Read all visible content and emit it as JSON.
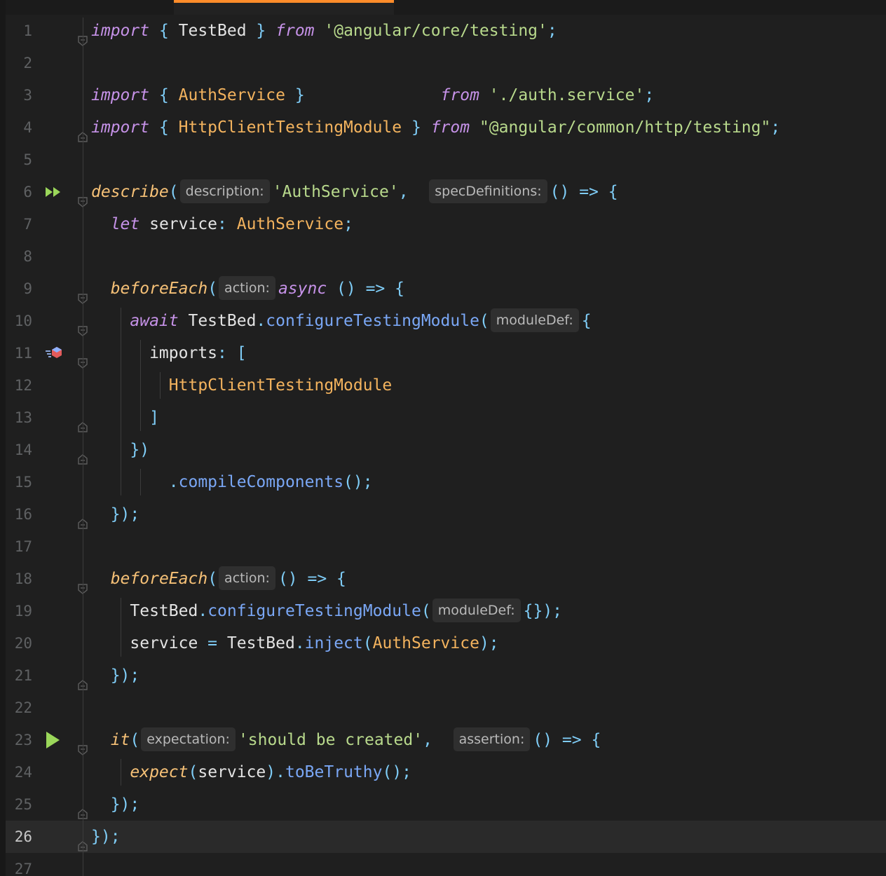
{
  "editor": {
    "current_line": 26,
    "lines": [
      {
        "n": "1",
        "tokens": [
          {
            "t": "import",
            "c": "kw"
          },
          {
            "t": " { ",
            "c": "pun"
          },
          {
            "t": "TestBed",
            "c": "plain"
          },
          {
            "t": " } ",
            "c": "pun"
          },
          {
            "t": "from",
            "c": "kw"
          },
          {
            "t": " ",
            "c": "plain"
          },
          {
            "t": "'@angular/core/testing'",
            "c": "str"
          },
          {
            "t": ";",
            "c": "pun"
          }
        ]
      },
      {
        "n": "2",
        "tokens": []
      },
      {
        "n": "3",
        "tokens": [
          {
            "t": "import",
            "c": "kw"
          },
          {
            "t": " { ",
            "c": "pun"
          },
          {
            "t": "AuthService",
            "c": "cls"
          },
          {
            "t": " }              ",
            "c": "pun"
          },
          {
            "t": "from",
            "c": "kw"
          },
          {
            "t": " ",
            "c": "plain"
          },
          {
            "t": "'./auth.service'",
            "c": "str"
          },
          {
            "t": ";",
            "c": "pun"
          }
        ]
      },
      {
        "n": "4",
        "tokens": [
          {
            "t": "import",
            "c": "kw"
          },
          {
            "t": " { ",
            "c": "pun"
          },
          {
            "t": "HttpClientTestingModule",
            "c": "cls"
          },
          {
            "t": " } ",
            "c": "pun"
          },
          {
            "t": "from",
            "c": "kw"
          },
          {
            "t": " ",
            "c": "plain"
          },
          {
            "t": "\"@angular/common/http/testing\"",
            "c": "str"
          },
          {
            "t": ";",
            "c": "pun"
          }
        ]
      },
      {
        "n": "5",
        "tokens": []
      },
      {
        "n": "6",
        "tokens": [
          {
            "t": "describe",
            "c": "fn"
          },
          {
            "t": "(",
            "c": "pun"
          },
          {
            "t": "description:",
            "c": "hint"
          },
          {
            "t": "'AuthService'",
            "c": "str"
          },
          {
            "t": ",  ",
            "c": "pun"
          },
          {
            "t": "specDefinitions:",
            "c": "hint"
          },
          {
            "t": "() => {",
            "c": "pun"
          }
        ]
      },
      {
        "n": "7",
        "tokens": [
          {
            "t": "  ",
            "c": "plain"
          },
          {
            "t": "let",
            "c": "kw"
          },
          {
            "t": " service",
            "c": "plain"
          },
          {
            "t": ": ",
            "c": "pun"
          },
          {
            "t": "AuthService",
            "c": "cls"
          },
          {
            "t": ";",
            "c": "pun"
          }
        ]
      },
      {
        "n": "8",
        "tokens": []
      },
      {
        "n": "9",
        "tokens": [
          {
            "t": "  ",
            "c": "plain"
          },
          {
            "t": "beforeEach",
            "c": "fn"
          },
          {
            "t": "(",
            "c": "pun"
          },
          {
            "t": "action:",
            "c": "hint"
          },
          {
            "t": "async",
            "c": "kw"
          },
          {
            "t": " () => {",
            "c": "pun"
          }
        ]
      },
      {
        "n": "10",
        "tokens": [
          {
            "t": "    ",
            "c": "plain"
          },
          {
            "t": "await",
            "c": "kw"
          },
          {
            "t": " TestBed",
            "c": "plain"
          },
          {
            "t": ".",
            "c": "pun"
          },
          {
            "t": "configureTestingModule",
            "c": "meth"
          },
          {
            "t": "(",
            "c": "pun"
          },
          {
            "t": "moduleDef:",
            "c": "hint"
          },
          {
            "t": "{",
            "c": "pun"
          }
        ]
      },
      {
        "n": "11",
        "tokens": [
          {
            "t": "      imports",
            "c": "plain"
          },
          {
            "t": ": [",
            "c": "pun"
          }
        ]
      },
      {
        "n": "12",
        "tokens": [
          {
            "t": "        ",
            "c": "plain"
          },
          {
            "t": "HttpClientTestingModule",
            "c": "cls"
          }
        ]
      },
      {
        "n": "13",
        "tokens": [
          {
            "t": "      ",
            "c": "plain"
          },
          {
            "t": "]",
            "c": "pun"
          }
        ]
      },
      {
        "n": "14",
        "tokens": [
          {
            "t": "    ",
            "c": "plain"
          },
          {
            "t": "})",
            "c": "pun"
          }
        ]
      },
      {
        "n": "15",
        "tokens": [
          {
            "t": "        ",
            "c": "plain"
          },
          {
            "t": ".",
            "c": "pun"
          },
          {
            "t": "compileComponents",
            "c": "meth"
          },
          {
            "t": "();",
            "c": "pun"
          }
        ]
      },
      {
        "n": "16",
        "tokens": [
          {
            "t": "  ",
            "c": "plain"
          },
          {
            "t": "});",
            "c": "pun"
          }
        ]
      },
      {
        "n": "17",
        "tokens": []
      },
      {
        "n": "18",
        "tokens": [
          {
            "t": "  ",
            "c": "plain"
          },
          {
            "t": "beforeEach",
            "c": "fn"
          },
          {
            "t": "(",
            "c": "pun"
          },
          {
            "t": "action:",
            "c": "hint"
          },
          {
            "t": "() => {",
            "c": "pun"
          }
        ]
      },
      {
        "n": "19",
        "tokens": [
          {
            "t": "    TestBed",
            "c": "plain"
          },
          {
            "t": ".",
            "c": "pun"
          },
          {
            "t": "configureTestingModule",
            "c": "meth"
          },
          {
            "t": "(",
            "c": "pun"
          },
          {
            "t": "moduleDef:",
            "c": "hint"
          },
          {
            "t": "{});",
            "c": "pun"
          }
        ]
      },
      {
        "n": "20",
        "tokens": [
          {
            "t": "    service ",
            "c": "plain"
          },
          {
            "t": "=",
            "c": "pun"
          },
          {
            "t": " TestBed",
            "c": "plain"
          },
          {
            "t": ".",
            "c": "pun"
          },
          {
            "t": "inject",
            "c": "meth"
          },
          {
            "t": "(",
            "c": "pun"
          },
          {
            "t": "AuthService",
            "c": "cls"
          },
          {
            "t": ");",
            "c": "pun"
          }
        ]
      },
      {
        "n": "21",
        "tokens": [
          {
            "t": "  ",
            "c": "plain"
          },
          {
            "t": "});",
            "c": "pun"
          }
        ]
      },
      {
        "n": "22",
        "tokens": []
      },
      {
        "n": "23",
        "tokens": [
          {
            "t": "  ",
            "c": "plain"
          },
          {
            "t": "it",
            "c": "fn"
          },
          {
            "t": "(",
            "c": "pun"
          },
          {
            "t": "expectation:",
            "c": "hint"
          },
          {
            "t": "'should be created'",
            "c": "str"
          },
          {
            "t": ",  ",
            "c": "pun"
          },
          {
            "t": "assertion:",
            "c": "hint"
          },
          {
            "t": "() => {",
            "c": "pun"
          }
        ]
      },
      {
        "n": "24",
        "tokens": [
          {
            "t": "    ",
            "c": "plain"
          },
          {
            "t": "expect",
            "c": "fn"
          },
          {
            "t": "(",
            "c": "pun"
          },
          {
            "t": "service",
            "c": "plain"
          },
          {
            "t": ").",
            "c": "pun"
          },
          {
            "t": "toBeTruthy",
            "c": "meth"
          },
          {
            "t": "();",
            "c": "pun"
          }
        ]
      },
      {
        "n": "25",
        "tokens": [
          {
            "t": "  ",
            "c": "plain"
          },
          {
            "t": "});",
            "c": "pun"
          }
        ]
      },
      {
        "n": "26",
        "tokens": [
          {
            "t": "});",
            "c": "pun"
          }
        ]
      },
      {
        "n": "27",
        "tokens": []
      }
    ],
    "gutter_icons": {
      "6": "run-all-tests-icon",
      "11": "angular-module-icon",
      "23": "run-test-icon"
    },
    "fold_markers": {
      "1": "open",
      "4": "close",
      "6": "open",
      "9": "open",
      "10": "open",
      "11": "open",
      "13": "close",
      "14": "close",
      "16": "close",
      "18": "open",
      "21": "close",
      "23": "open",
      "25": "close",
      "26": "close"
    },
    "colors": {
      "background": "#1f1f1f",
      "current_line": "#2a2a2a",
      "tab_accent": "#ff8c2a",
      "keyword": "#c692e8",
      "function": "#f6c177",
      "class": "#f3b35e",
      "string": "#b8d98c",
      "punctuation": "#7fcdf7",
      "method": "#7aa7f5",
      "run_icon": "#9bd75a"
    }
  }
}
